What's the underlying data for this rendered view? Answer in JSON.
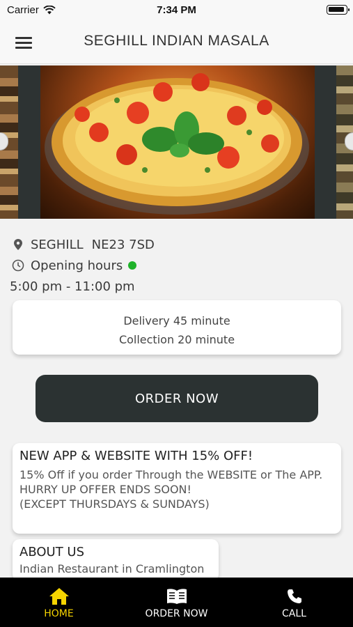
{
  "status_bar": {
    "carrier": "Carrier",
    "time": "7:34 PM"
  },
  "header": {
    "title": "SEGHILL INDIAN MASALA"
  },
  "location": {
    "area": "SEGHILL",
    "postcode": "NE23 7SD"
  },
  "opening": {
    "label": "Opening hours",
    "hours": "5:00 pm - 11:00 pm",
    "status_color": "#1fb22a"
  },
  "delivery_card": {
    "delivery": "Delivery 45 minute",
    "collection": "Collection 20 minute"
  },
  "order_button": {
    "label": "ORDER NOW"
  },
  "promo": {
    "title": "NEW APP & WEBSITE WITH 15% OFF!",
    "body": "15% Off if you order Through the WEBSITE or The APP.\nHURRY UP OFFER ENDS SOON!\n(EXCEPT THURSDAYS & SUNDAYS)"
  },
  "about": {
    "title": "ABOUT US",
    "body": "Indian Restaurant in Cramlington"
  },
  "tabs": [
    {
      "label": "HOME",
      "icon": "home-icon",
      "active": true
    },
    {
      "label": "ORDER NOW",
      "icon": "menu-book-icon",
      "active": false
    },
    {
      "label": "CALL",
      "icon": "phone-icon",
      "active": false
    }
  ],
  "colors": {
    "accent": "#f5d400",
    "button": "#2b3232",
    "tabbar": "#000000"
  }
}
